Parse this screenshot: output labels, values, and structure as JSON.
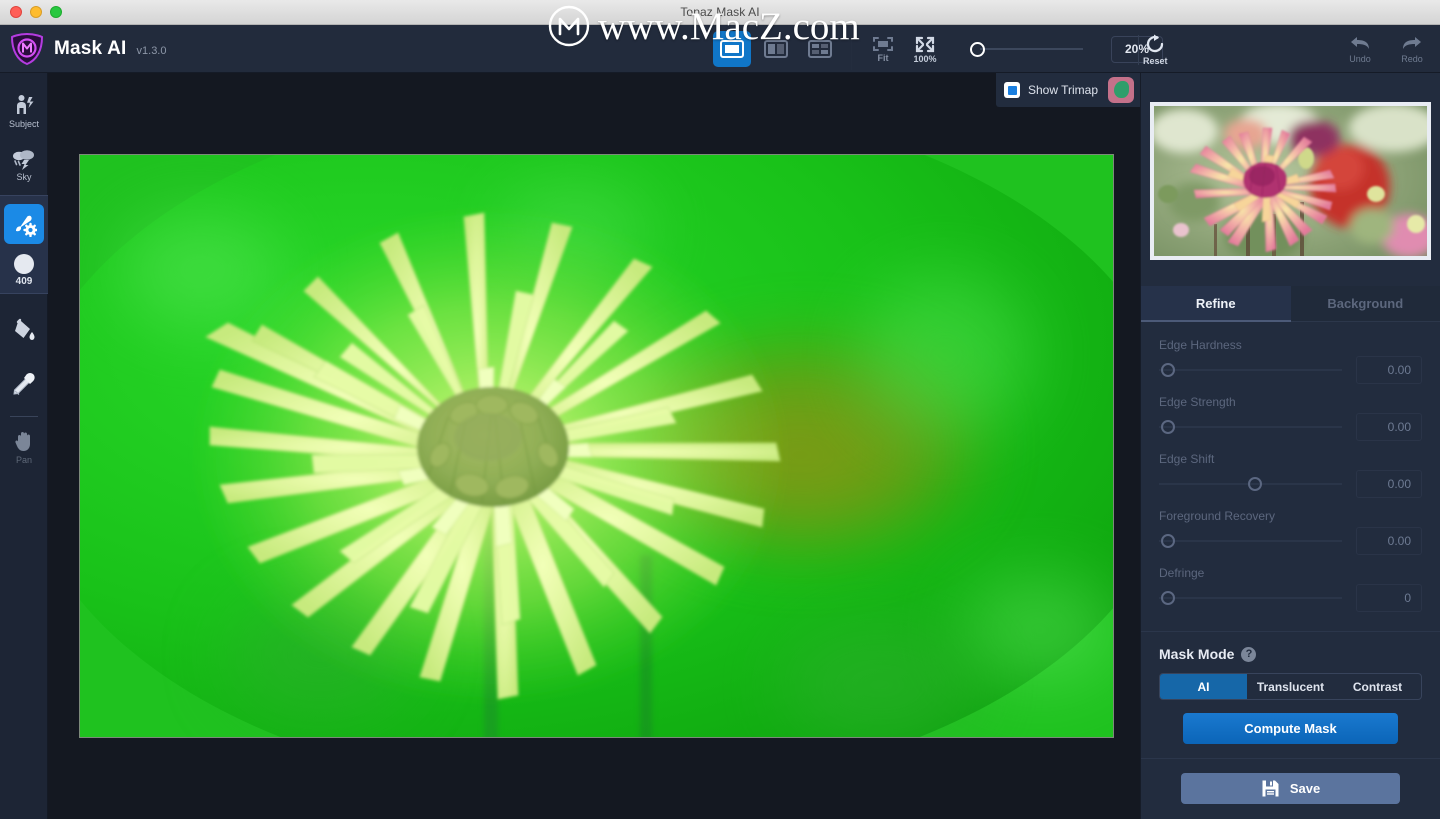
{
  "window": {
    "title": "Topaz Mask AI",
    "controls": [
      "close",
      "minimize",
      "maximize"
    ]
  },
  "watermark": {
    "text": "www.MacZ.com",
    "logo": "macz-m-logo"
  },
  "header": {
    "app_name": "Mask AI",
    "version": "v1.3.0",
    "view_modes": [
      {
        "name": "single-view",
        "active": true
      },
      {
        "name": "split-view",
        "active": false
      },
      {
        "name": "quad-view",
        "active": false
      }
    ],
    "fit_label": "Fit",
    "hundred_label": "100%",
    "zoom_value": "20%",
    "zoom_percent": 20,
    "reset_label": "Reset",
    "undo_label": "Undo",
    "redo_label": "Redo"
  },
  "sidebar": {
    "items": [
      {
        "label": "Subject",
        "icon": "subject-icon",
        "active": false
      },
      {
        "label": "Sky",
        "icon": "sky-icon",
        "active": false
      },
      {
        "label": "",
        "icon": "brush-settings-icon",
        "active": true
      },
      {
        "label": "409",
        "icon": "brush-size-icon",
        "active": false
      },
      {
        "label": "",
        "icon": "fill-bucket-icon",
        "active": false
      },
      {
        "label": "",
        "icon": "eyedropper-icon",
        "active": false
      },
      {
        "label": "Pan",
        "icon": "pan-hand-icon",
        "active": false
      }
    ],
    "brush_size": "409"
  },
  "trimap": {
    "checkbox_checked": true,
    "label": "Show Trimap",
    "thumbnail": "trimap-preview-thumbnail"
  },
  "right_panel": {
    "preview_image": "dahlia-flower-preview",
    "tabs": [
      {
        "label": "Refine",
        "active": true
      },
      {
        "label": "Background",
        "active": false
      }
    ],
    "sliders": [
      {
        "label": "Edge Hardness",
        "value": "0.00",
        "knob_percent": 1
      },
      {
        "label": "Edge Strength",
        "value": "0.00",
        "knob_percent": 1
      },
      {
        "label": "Edge Shift",
        "value": "0.00",
        "knob_percent": 50
      },
      {
        "label": "Foreground Recovery",
        "value": "0.00",
        "knob_percent": 1
      },
      {
        "label": "Defringe",
        "value": "0",
        "knob_percent": 1
      }
    ],
    "mask_mode": {
      "title": "Mask Mode",
      "help_glyph": "?",
      "options": [
        {
          "label": "AI",
          "active": true
        },
        {
          "label": "Translucent",
          "active": false
        },
        {
          "label": "Contrast",
          "active": false
        }
      ],
      "compute_label": "Compute Mask"
    },
    "save_label": "Save"
  },
  "colors": {
    "accent_blue": "#1b8ae6",
    "panel_bg": "#222c3e",
    "canvas_bg": "#141821",
    "sidebar_bg": "#1d2535",
    "primary_button": "#1076c8",
    "save_button": "#5b749e",
    "trimap_green": "#1fc21f"
  }
}
